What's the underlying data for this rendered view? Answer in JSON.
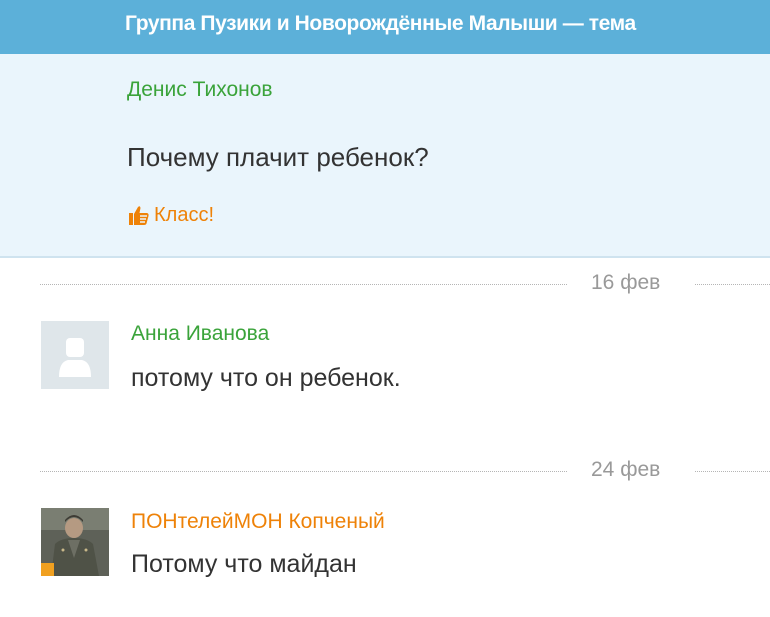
{
  "header": {
    "title": "Группа Пузики и Новорождённые Малыши — тема"
  },
  "post": {
    "author": "Денис Тихонов",
    "text": "Почему плачит ребенок?",
    "like_label": "Класс!"
  },
  "comments": [
    {
      "date": "16 фев",
      "author": "Анна Иванова",
      "text": "потому что он ребенок."
    },
    {
      "date": "24 фев",
      "author": "ПОНтелейМОН Копченый",
      "text": "Потому что майдан"
    }
  ],
  "colors": {
    "header_bg": "#5cb0d9",
    "post_bg": "#eaf5fc",
    "author_green": "#3aa33a",
    "author_orange": "#ee8208",
    "like_orange": "#ee8208",
    "online_badge": "#f0a020"
  },
  "icons": {
    "like": "thumbs-up-icon",
    "placeholder_avatar": "user-silhouette-icon",
    "online": "online-badge-icon"
  }
}
